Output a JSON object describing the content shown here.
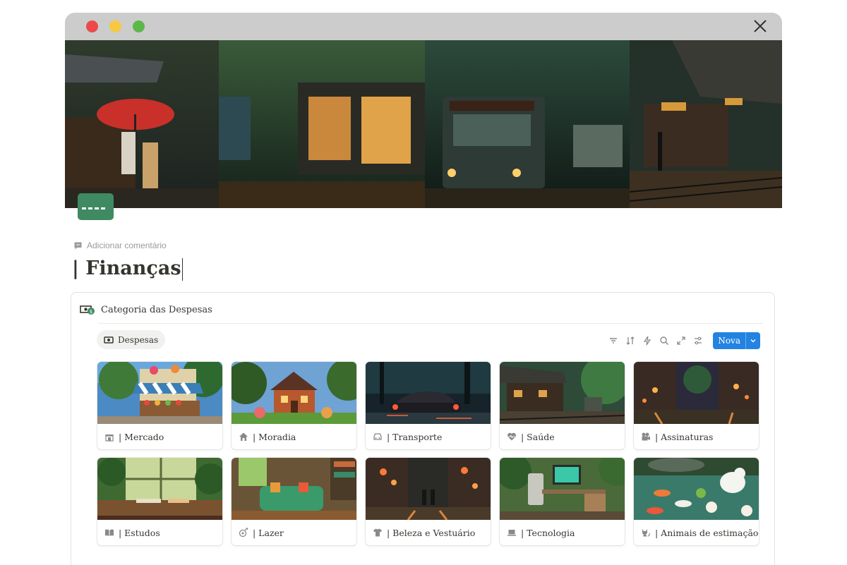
{
  "window": {
    "traffic_lights": {
      "close": "#ec4a4a",
      "minimize": "#f7c843",
      "maximize": "#5cb84a"
    }
  },
  "page": {
    "icon": "credit-card-icon",
    "comment_label": "Adicionar comentário",
    "title": "| Finanças"
  },
  "database": {
    "icon": "money-icon",
    "title": "Categoria das Despesas",
    "view_tab": {
      "icon": "money-icon",
      "label": "Despesas"
    },
    "toolbar": {
      "icons": [
        "filter-icon",
        "sort-icon",
        "lightning-icon",
        "search-icon",
        "expand-icon",
        "settings-icon"
      ],
      "new_button": "Nova"
    },
    "cards": [
      {
        "label": "| Mercado",
        "icon": "market-icon",
        "scene": "market"
      },
      {
        "label": "| Moradia",
        "icon": "home-icon",
        "scene": "house"
      },
      {
        "label": "| Transporte",
        "icon": "car-icon",
        "scene": "car"
      },
      {
        "label": "| Saúde",
        "icon": "heart-pulse-icon",
        "scene": "station"
      },
      {
        "label": "| Assinaturas",
        "icon": "camera-icon",
        "scene": "street"
      },
      {
        "label": "| Estudos",
        "icon": "book-icon",
        "scene": "study"
      },
      {
        "label": "| Lazer",
        "icon": "leisure-icon",
        "scene": "livingroom"
      },
      {
        "label": "| Beleza e Vestuário",
        "icon": "shirt-icon",
        "scene": "lanterns"
      },
      {
        "label": "| Tecnologia",
        "icon": "laptop-icon",
        "scene": "desk"
      },
      {
        "label": "| Animais de estimação",
        "icon": "cat-icon",
        "scene": "pond"
      }
    ]
  },
  "colors": {
    "accent": "#2383e2",
    "page_icon_bg": "#3f8a63",
    "text": "#37352f",
    "muted": "#9b9a97"
  }
}
